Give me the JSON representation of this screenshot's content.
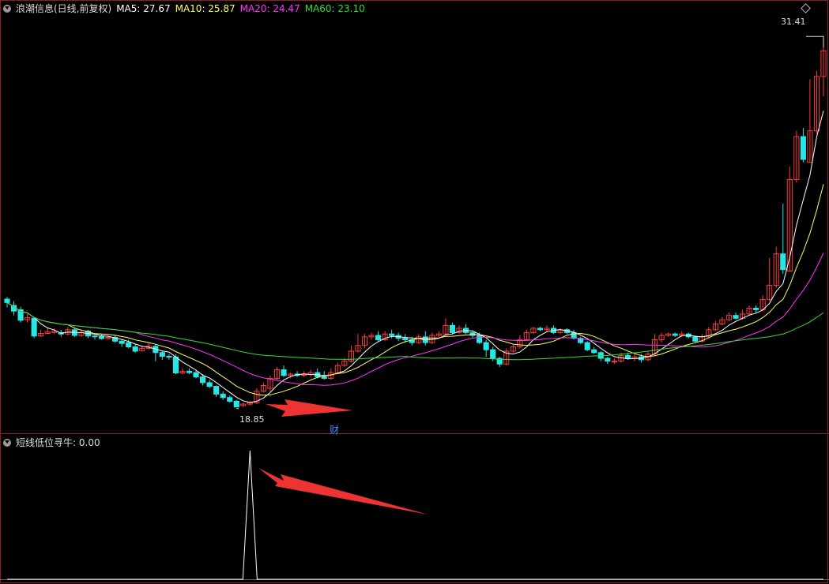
{
  "main_header": {
    "title": "浪潮信息(日线,前复权)",
    "ma5": "MA5: 27.67",
    "ma10": "MA10: 25.87",
    "ma20": "MA20: 24.47",
    "ma60": "MA60: 23.10"
  },
  "sub_header": {
    "title": "短线低位寻牛",
    "value": ": 0.00"
  },
  "annotations": {
    "high_label": "31.41",
    "low_label": "18.85",
    "fin_marker": "财"
  },
  "colors": {
    "up": "#ff3a3a",
    "down": "#26e6e6",
    "ma5": "#ffffff",
    "ma10": "#ffff66",
    "ma20": "#ff33ff",
    "ma60": "#33dd33",
    "frame": "#8b1f1f",
    "arrow": "#ee3333"
  },
  "chart_data": [
    {
      "type": "candlestick",
      "title": "浪潮信息(日线,前复权)",
      "ylim": [
        18.4,
        32.3
      ],
      "series_names": [
        "MA5",
        "MA10",
        "MA20",
        "MA60"
      ],
      "last_values": {
        "MA5": 27.67,
        "MA10": 25.87,
        "MA20": 24.47,
        "MA60": 23.1
      },
      "high_marker": 31.41,
      "low_marker": 18.85,
      "candles": [
        [
          22.62,
          22.5,
          22.7,
          22.33
        ],
        [
          22.4,
          22.2,
          22.55,
          22.05
        ],
        [
          22.25,
          21.88,
          22.35,
          21.8
        ],
        [
          21.9,
          21.97,
          22.1,
          21.8
        ],
        [
          21.95,
          21.33,
          22.0,
          21.25
        ],
        [
          21.33,
          21.42,
          21.55,
          21.3
        ],
        [
          21.42,
          21.47,
          21.6,
          21.4
        ],
        [
          21.45,
          21.5,
          21.6,
          21.4
        ],
        [
          21.45,
          21.4,
          21.55,
          21.3
        ],
        [
          21.4,
          21.55,
          21.65,
          21.35
        ],
        [
          21.55,
          21.35,
          21.6,
          21.3
        ],
        [
          21.35,
          21.45,
          21.55,
          21.3
        ],
        [
          21.5,
          21.33,
          21.55,
          21.25
        ],
        [
          21.33,
          21.31,
          21.4,
          21.2
        ],
        [
          21.31,
          21.24,
          21.4,
          21.2
        ],
        [
          21.24,
          21.28,
          21.35,
          21.2
        ],
        [
          21.28,
          21.15,
          21.35,
          21.1
        ],
        [
          21.15,
          21.07,
          21.2,
          20.95
        ],
        [
          21.1,
          20.95,
          21.2,
          20.9
        ],
        [
          20.95,
          20.8,
          21.05,
          20.75
        ],
        [
          20.82,
          20.9,
          21.0,
          20.8
        ],
        [
          20.9,
          20.97,
          21.1,
          20.85
        ],
        [
          20.97,
          20.75,
          21.05,
          20.45
        ],
        [
          20.75,
          20.62,
          20.8,
          20.5
        ],
        [
          20.62,
          20.6,
          20.7,
          20.5
        ],
        [
          20.6,
          20.04,
          20.7,
          20.0
        ],
        [
          20.04,
          20.1,
          20.2,
          20.0
        ],
        [
          20.1,
          20.05,
          20.2,
          20.0
        ],
        [
          20.05,
          19.9,
          20.15,
          19.85
        ],
        [
          19.9,
          19.7,
          20.0,
          19.6
        ],
        [
          19.7,
          19.57,
          19.8,
          19.5
        ],
        [
          19.57,
          19.3,
          19.6,
          19.2
        ],
        [
          19.3,
          19.18,
          19.4,
          19.1
        ],
        [
          19.18,
          19.05,
          19.25,
          19.0
        ],
        [
          19.05,
          18.85,
          19.1,
          18.85
        ],
        [
          18.9,
          18.95,
          19.0,
          18.85
        ],
        [
          18.95,
          19.0,
          19.05,
          18.9
        ],
        [
          19.0,
          19.4,
          19.5,
          18.95
        ],
        [
          19.4,
          19.6,
          19.7,
          19.35
        ],
        [
          19.5,
          19.85,
          19.95,
          19.4
        ],
        [
          19.85,
          20.15,
          20.25,
          19.8
        ],
        [
          20.15,
          19.95,
          20.3,
          19.9
        ],
        [
          19.95,
          20.0,
          20.05,
          19.85
        ],
        [
          20.0,
          19.95,
          20.1,
          19.9
        ],
        [
          19.95,
          19.98,
          20.1,
          19.9
        ],
        [
          19.98,
          20.05,
          20.15,
          19.9
        ],
        [
          20.05,
          19.9,
          20.2,
          19.85
        ],
        [
          19.9,
          19.85,
          20.1,
          19.8
        ],
        [
          19.85,
          20.05,
          20.2,
          19.8
        ],
        [
          20.05,
          20.3,
          20.4,
          20.0
        ],
        [
          20.3,
          20.45,
          20.55,
          20.25
        ],
        [
          20.45,
          20.8,
          21.0,
          20.4
        ],
        [
          20.8,
          21.0,
          21.4,
          20.75
        ],
        [
          21.0,
          21.3,
          21.4,
          20.9
        ],
        [
          21.3,
          21.35,
          21.45,
          21.2
        ],
        [
          21.35,
          21.2,
          21.5,
          21.15
        ],
        [
          21.2,
          21.4,
          21.5,
          21.15
        ],
        [
          21.4,
          21.35,
          21.55,
          21.25
        ],
        [
          21.35,
          21.25,
          21.45,
          21.15
        ],
        [
          21.25,
          21.2,
          21.4,
          21.1
        ],
        [
          21.2,
          21.1,
          21.3,
          21.0
        ],
        [
          21.1,
          21.3,
          21.4,
          21.05
        ],
        [
          21.3,
          21.1,
          21.5,
          21.0
        ],
        [
          21.1,
          21.35,
          21.45,
          21.05
        ],
        [
          21.35,
          21.4,
          21.5,
          21.3
        ],
        [
          21.4,
          21.7,
          21.95,
          21.35
        ],
        [
          21.7,
          21.45,
          21.8,
          21.4
        ],
        [
          21.45,
          21.6,
          21.7,
          21.4
        ],
        [
          21.6,
          21.45,
          21.75,
          21.4
        ],
        [
          21.45,
          21.35,
          21.5,
          21.25
        ],
        [
          21.35,
          21.1,
          21.45,
          21.05
        ],
        [
          21.1,
          20.85,
          21.2,
          20.6
        ],
        [
          20.85,
          20.55,
          20.95,
          20.45
        ],
        [
          20.55,
          20.35,
          20.6,
          20.25
        ],
        [
          20.35,
          20.8,
          20.9,
          20.3
        ],
        [
          20.8,
          20.95,
          21.05,
          20.75
        ],
        [
          20.95,
          21.2,
          21.35,
          20.9
        ],
        [
          21.2,
          21.45,
          21.55,
          21.15
        ],
        [
          21.45,
          21.6,
          21.65,
          21.4
        ],
        [
          21.6,
          21.55,
          21.65,
          21.5
        ],
        [
          21.55,
          21.6,
          21.7,
          21.5
        ],
        [
          21.6,
          21.45,
          21.7,
          21.4
        ],
        [
          21.45,
          21.55,
          21.6,
          21.4
        ],
        [
          21.55,
          21.45,
          21.6,
          21.4
        ],
        [
          21.45,
          21.25,
          21.55,
          21.2
        ],
        [
          21.25,
          21.1,
          21.3,
          21.05
        ],
        [
          21.1,
          20.85,
          21.15,
          20.8
        ],
        [
          20.85,
          20.75,
          20.95,
          20.7
        ],
        [
          20.75,
          20.55,
          20.8,
          20.45
        ],
        [
          20.55,
          20.45,
          20.6,
          20.35
        ],
        [
          20.45,
          20.45,
          20.55,
          20.35
        ],
        [
          20.45,
          20.65,
          20.75,
          20.4
        ],
        [
          20.65,
          20.55,
          20.75,
          20.5
        ],
        [
          20.55,
          20.6,
          20.7,
          20.45
        ],
        [
          20.6,
          20.5,
          20.7,
          20.4
        ],
        [
          20.5,
          20.7,
          20.8,
          20.45
        ],
        [
          20.7,
          21.2,
          21.4,
          20.65
        ],
        [
          21.2,
          21.35,
          21.45,
          21.1
        ],
        [
          21.35,
          21.4,
          21.45,
          21.3
        ],
        [
          21.4,
          21.35,
          21.45,
          21.3
        ],
        [
          21.35,
          21.4,
          21.5,
          21.3
        ],
        [
          21.4,
          21.3,
          21.45,
          21.25
        ],
        [
          21.3,
          21.15,
          21.35,
          21.1
        ],
        [
          21.15,
          21.3,
          21.4,
          21.1
        ],
        [
          21.3,
          21.55,
          21.65,
          21.25
        ],
        [
          21.55,
          21.75,
          21.85,
          21.5
        ],
        [
          21.75,
          21.9,
          22.0,
          21.7
        ],
        [
          21.9,
          22.05,
          22.15,
          21.85
        ],
        [
          22.05,
          21.95,
          22.15,
          21.9
        ],
        [
          21.95,
          22.1,
          22.25,
          21.9
        ],
        [
          22.1,
          22.3,
          22.4,
          22.05
        ],
        [
          22.3,
          22.25,
          22.4,
          22.15
        ],
        [
          22.25,
          22.6,
          22.75,
          22.2
        ],
        [
          22.6,
          23.1,
          24.05,
          22.55
        ],
        [
          23.1,
          24.2,
          24.45,
          23.0
        ],
        [
          24.2,
          23.65,
          25.95,
          23.5
        ],
        [
          23.6,
          26.8,
          27.25,
          23.6
        ],
        [
          26.8,
          28.3,
          28.5,
          26.7
        ],
        [
          28.3,
          27.5,
          28.6,
          27.4
        ],
        [
          27.4,
          28.5,
          30.3,
          27.4
        ],
        [
          28.5,
          30.4,
          30.6,
          28.4
        ],
        [
          30.4,
          31.3,
          31.41,
          29.7
        ]
      ]
    },
    {
      "type": "line",
      "title": "短线低位寻牛",
      "current_value": 0.0,
      "signal_peak": 1.0,
      "signal_index": 36
    }
  ]
}
